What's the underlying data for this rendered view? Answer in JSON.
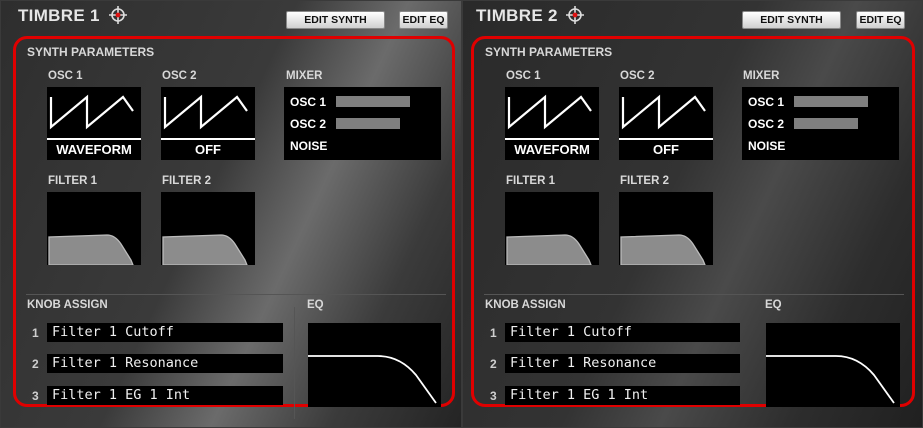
{
  "timbres": [
    {
      "title": "TIMBRE 1",
      "edit_synth_label": "EDIT SYNTH",
      "edit_eq_label": "EDIT EQ",
      "section_title": "SYNTH PARAMETERS",
      "osc1": {
        "label": "OSC 1",
        "value": "WAVEFORM"
      },
      "osc2": {
        "label": "OSC 2",
        "value": "OFF"
      },
      "mixer": {
        "label": "MIXER",
        "rows": [
          {
            "name": "OSC 1",
            "level": 0.85
          },
          {
            "name": "OSC 2",
            "level": 0.75
          },
          {
            "name": "NOISE",
            "level": 0
          }
        ]
      },
      "filter1": {
        "label": "FILTER 1"
      },
      "filter2": {
        "label": "FILTER 2"
      },
      "knob_assign": {
        "label": "KNOB ASSIGN",
        "items": [
          {
            "num": "1",
            "value": "Filter 1 Cutoff"
          },
          {
            "num": "2",
            "value": "Filter 1 Resonance"
          },
          {
            "num": "3",
            "value": "Filter 1 EG 1 Int"
          }
        ]
      },
      "eq": {
        "label": "EQ"
      }
    },
    {
      "title": "TIMBRE 2",
      "edit_synth_label": "EDIT SYNTH",
      "edit_eq_label": "EDIT EQ",
      "section_title": "SYNTH PARAMETERS",
      "osc1": {
        "label": "OSC 1",
        "value": "WAVEFORM"
      },
      "osc2": {
        "label": "OSC 2",
        "value": "OFF"
      },
      "mixer": {
        "label": "MIXER",
        "rows": [
          {
            "name": "OSC 1",
            "level": 0.85
          },
          {
            "name": "OSC 2",
            "level": 0.75
          },
          {
            "name": "NOISE",
            "level": 0
          }
        ]
      },
      "filter1": {
        "label": "FILTER 1"
      },
      "filter2": {
        "label": "FILTER 2"
      },
      "knob_assign": {
        "label": "KNOB ASSIGN",
        "items": [
          {
            "num": "1",
            "value": "Filter 1 Cutoff"
          },
          {
            "num": "2",
            "value": "Filter 1 Resonance"
          },
          {
            "num": "3",
            "value": "Filter 1 EG 1 Int"
          }
        ]
      },
      "eq": {
        "label": "EQ"
      }
    }
  ],
  "colors": {
    "highlight": "#e00000",
    "bar": "#7f7f7f"
  },
  "icons": {
    "target": "crosshair-icon"
  }
}
